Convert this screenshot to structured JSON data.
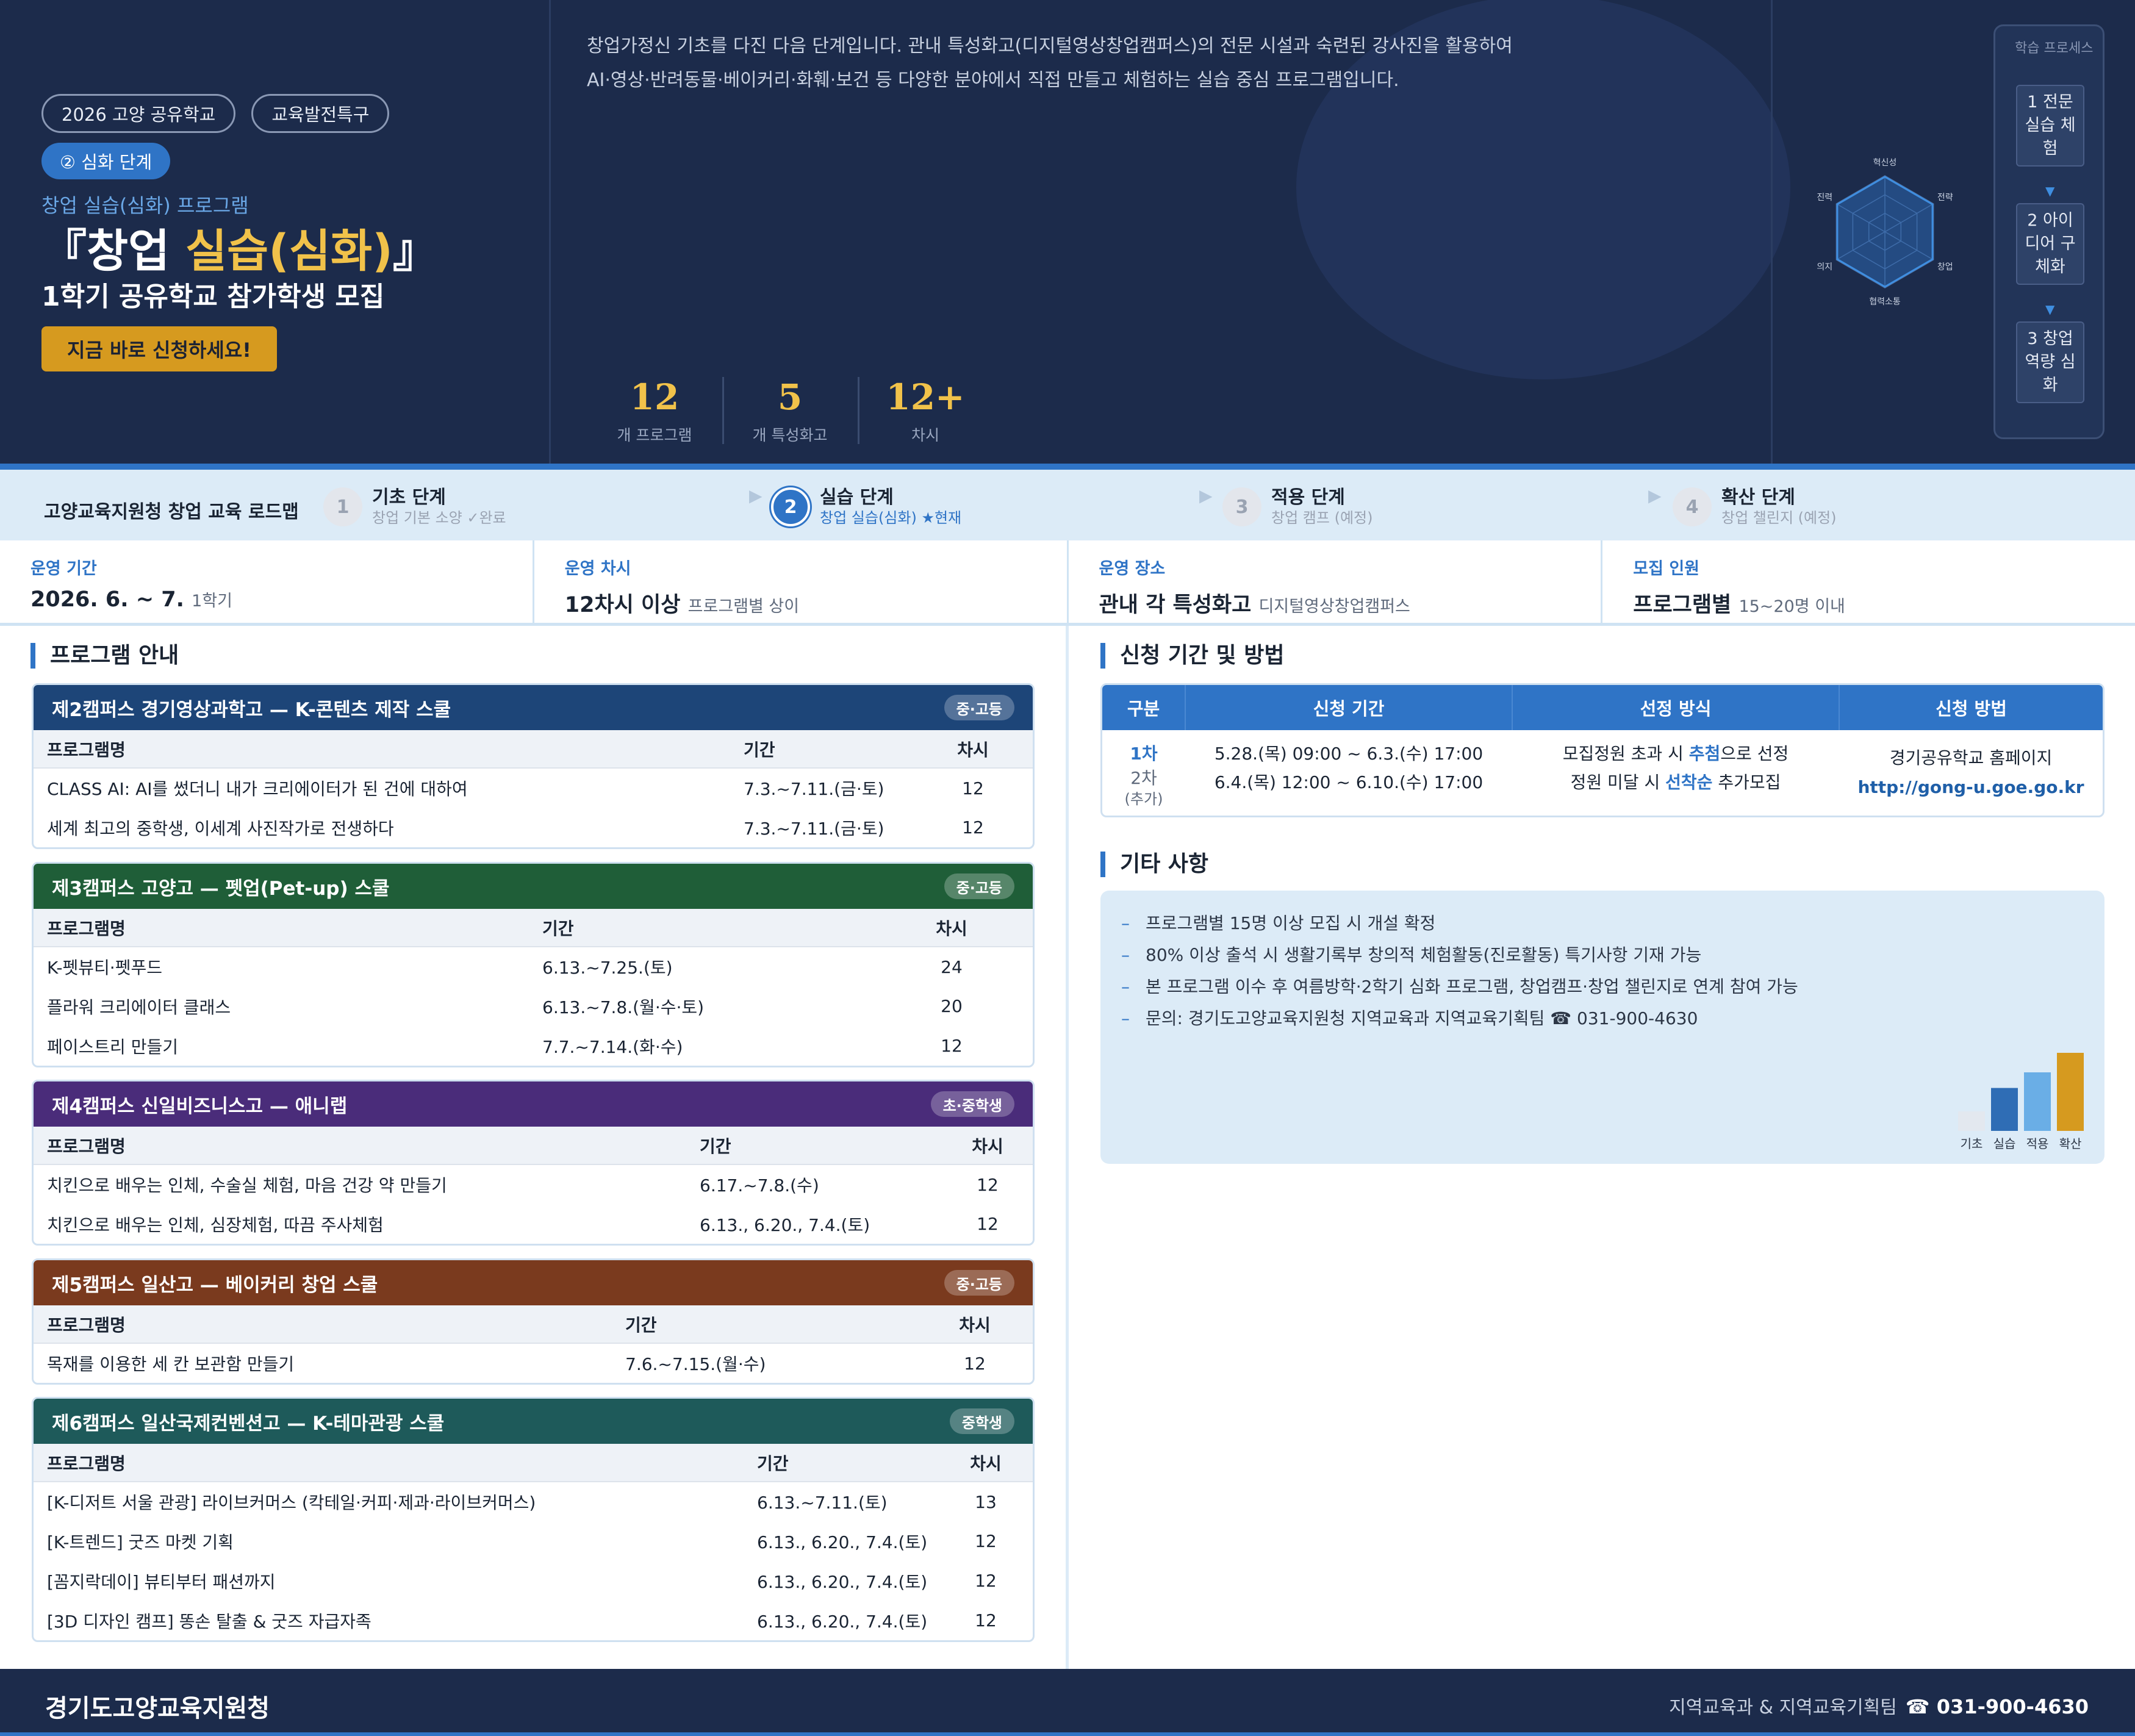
{
  "hero": {
    "tags": [
      "2026 고양 공유학교",
      "교육발전특구"
    ],
    "stage_pill": "② 심화 단계",
    "subtitle": "창업 실습(심화) 프로그램",
    "title_prefix": "『창업 ",
    "title_highlight": "실습(심화)",
    "title_suffix": "』",
    "title_line2": "1학기 공유학교 참가학생 모집",
    "cta": "지금 바로 신청하세요!",
    "intro_line1": "창업가정신 기초를 다진 다음 단계입니다. 관내 특성화고(디지털영상창업캠퍼스)의 전문 시설과 숙련된 강사진을 활용하여",
    "intro_line2": "AI·영상·반려동물·베이커리·화훼·보건 등 다양한 분야에서 직접 만들고 체험하는 실습 중심 프로그램입니다.",
    "stats": [
      {
        "num": "12",
        "label": "개 프로그램"
      },
      {
        "num": "5",
        "label": "개 특성화고"
      },
      {
        "num": "12+",
        "label": "차시"
      }
    ],
    "radar_labels": [
      "혁신성",
      "전략",
      "창업",
      "협력소통",
      "의지",
      "진력"
    ],
    "process_title": "학습 프로세스",
    "process_steps": [
      "1 전문 실습 체험",
      "2 아이디어 구체화",
      "3 창업 역량 심화"
    ],
    "process_arrow": "▼"
  },
  "roadmap": {
    "label": "고양교육지원청 창업 교육 로드맵",
    "arrow": "▶",
    "steps": [
      {
        "num": "1",
        "name": "기초 단계",
        "desc": "창업 기본 소양 ✓완료"
      },
      {
        "num": "2",
        "name": "실습 단계",
        "desc": "창업 실습(심화) ★현재"
      },
      {
        "num": "3",
        "name": "적용 단계",
        "desc": "창업 캠프 (예정)"
      },
      {
        "num": "4",
        "name": "확산 단계",
        "desc": "창업 챌린지 (예정)"
      }
    ]
  },
  "info": [
    {
      "label": "운영 기간",
      "value": "2026. 6. ~ 7.",
      "sub": "1학기"
    },
    {
      "label": "운영 차시",
      "value": "12차시 이상",
      "sub": "프로그램별 상이"
    },
    {
      "label": "운영 장소",
      "value": "관내 각 특성화고",
      "sub": "디지털영상창업캠퍼스"
    },
    {
      "label": "모집 인원",
      "value": "프로그램별",
      "sub": "15~20명 이내"
    }
  ],
  "program_section_title": "프로그램 안내",
  "col_headers": {
    "name": "프로그램명",
    "period": "기간",
    "sessions": "차시"
  },
  "campuses": [
    {
      "title": "제2캠퍼스 경기영상과학고 — K-콘텐츠 제작 스쿨",
      "badge": "중·고등",
      "color": "#1d4578",
      "rows": [
        {
          "name": "CLASS AI: AI를 썼더니 내가 크리에이터가 된 건에 대하여",
          "period": "7.3.~7.11.(금·토)",
          "sessions": "12"
        },
        {
          "name": "세계 최고의 중학생, 이세계 사진작가로 전생하다",
          "period": "7.3.~7.11.(금·토)",
          "sessions": "12"
        }
      ]
    },
    {
      "title": "제3캠퍼스 고양고 — 펫업(Pet-up) 스쿨",
      "badge": "중·고등",
      "color": "#1f5e38",
      "rows": [
        {
          "name": "K-펫뷰티·펫푸드",
          "period": "6.13.~7.25.(토)",
          "sessions": "24"
        },
        {
          "name": "플라워 크리에이터 클래스",
          "period": "6.13.~7.8.(월·수·토)",
          "sessions": "20"
        },
        {
          "name": "페이스트리 만들기",
          "period": "7.7.~7.14.(화·수)",
          "sessions": "12"
        }
      ]
    },
    {
      "title": "제4캠퍼스 신일비즈니스고 — 애니랩",
      "badge": "초·중학생",
      "color": "#4a2c7a",
      "rows": [
        {
          "name": "치킨으로 배우는 인체, 수술실 체험, 마음 건강 약 만들기",
          "period": "6.17.~7.8.(수)",
          "sessions": "12"
        },
        {
          "name": "치킨으로 배우는 인체, 심장체험, 따끔 주사체험",
          "period": "6.13., 6.20., 7.4.(토)",
          "sessions": "12"
        }
      ]
    },
    {
      "title": "제5캠퍼스 일산고 — 베이커리 창업 스쿨",
      "badge": "중·고등",
      "color": "#7a3a1e",
      "rows": [
        {
          "name": "목재를 이용한 세 칸 보관함 만들기",
          "period": "7.6.~7.15.(월·수)",
          "sessions": "12"
        }
      ]
    },
    {
      "title": "제6캠퍼스 일산국제컨벤션고 — K-테마관광 스쿨",
      "badge": "중학생",
      "color": "#1e5a5a",
      "rows": [
        {
          "name": "[K-디저트 서울 관광] 라이브커머스 (칵테일·커피·제과·라이브커머스)",
          "period": "6.13.~7.11.(토)",
          "sessions": "13"
        },
        {
          "name": "[K-트렌드] 굿즈 마켓 기획",
          "period": "6.13., 6.20., 7.4.(토)",
          "sessions": "12"
        },
        {
          "name": "[꼼지락데이] 뷰티부터 패션까지",
          "period": "6.13., 6.20., 7.4.(토)",
          "sessions": "12"
        },
        {
          "name": "[3D 디자인 캠프] 똥손 탈출 & 굿즈 자급자족",
          "period": "6.13., 6.20., 7.4.(토)",
          "sessions": "12"
        }
      ]
    }
  ],
  "apply": {
    "title": "신청 기간 및 방법",
    "headers": [
      "구분",
      "신청 기간",
      "선정 방식",
      "신청 방법"
    ],
    "round1": {
      "label": "1차",
      "period": "5.28.(목) 09:00 ~ 6.3.(수) 17:00",
      "method_a": "모집정원 초과 시 ",
      "method_b": "추첨",
      "method_c": "으로 선정"
    },
    "round2": {
      "label": "2차",
      "label_sub": "(추가)",
      "period": "6.4.(목) 12:00 ~ 6.10.(수) 17:00",
      "method_a": "정원 미달 시 ",
      "method_b": "선착순",
      "method_c": " 추가모집"
    },
    "how": "경기공유학교 홈페이지",
    "url": "http://gong-u.goe.go.kr"
  },
  "notes": {
    "title": "기타 사항",
    "dash": "–",
    "items": [
      "프로그램별 15명 이상 모집 시 개설 확정",
      "80% 이상 출석 시 생활기록부 창의적 체험활동(진로활동) 특기사항 기재 가능",
      "본 프로그램 이수 후 여름방학·2학기 심화 프로그램, 창업캠프·창업 챌린지로 연계 참여 가능",
      "문의: 경기도고양교육지원청 지역교육과 지역교육기획팀 ☎ 031-900-4630"
    ],
    "mini_chart": {
      "labels": [
        "기초",
        "실습",
        "적용",
        "확산"
      ],
      "values": [
        1,
        2.2,
        3,
        4
      ],
      "colors": [
        "#e3e8ef",
        "#2f6db5",
        "#6aaee6",
        "#d69a1f"
      ]
    }
  },
  "footer": {
    "org": "경기도고양교육지원청",
    "dept": "지역교육과 & 지역교육기획팀",
    "tel": "☎ 031-900-4630"
  }
}
